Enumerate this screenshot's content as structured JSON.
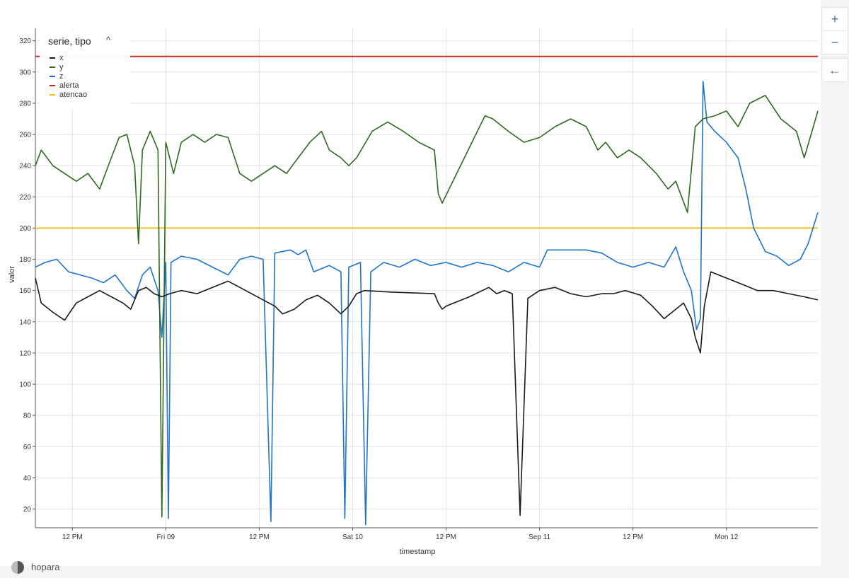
{
  "chart_data": {
    "type": "line",
    "xlabel": "timestamp",
    "ylabel": "valor",
    "ylim": [
      8,
      328
    ],
    "yticks": [
      20,
      40,
      60,
      80,
      100,
      120,
      140,
      160,
      180,
      200,
      220,
      240,
      260,
      280,
      300,
      320
    ],
    "xlim": [
      "2024-02-08 07:15",
      "2024-02-12 11:45"
    ],
    "xticks": [
      {
        "t": "2024-02-08 12:00",
        "label": "12 PM"
      },
      {
        "t": "2024-02-09 00:00",
        "label": "Fri 09"
      },
      {
        "t": "2024-02-09 12:00",
        "label": "12 PM"
      },
      {
        "t": "2024-02-10 00:00",
        "label": "Sat 10"
      },
      {
        "t": "2024-02-10 12:00",
        "label": "12 PM"
      },
      {
        "t": "2024-02-11 00:00",
        "label": "Sep 11"
      },
      {
        "t": "2024-02-11 12:00",
        "label": "12 PM"
      },
      {
        "t": "2024-02-12 00:00",
        "label": "Mon 12"
      }
    ],
    "legend_title": "serie, tipo",
    "legend_position": "top-left",
    "grid": true,
    "series": [
      {
        "name": "x",
        "color": "#1a1a1a",
        "points": [
          [
            "2024-02-08 07:15",
            168
          ],
          [
            "2024-02-08 08:00",
            152
          ],
          [
            "2024-02-08 09:30",
            146
          ],
          [
            "2024-02-08 11:00",
            141
          ],
          [
            "2024-02-08 12:30",
            152
          ],
          [
            "2024-02-08 14:00",
            156
          ],
          [
            "2024-02-08 15:30",
            160
          ],
          [
            "2024-02-08 17:00",
            156
          ],
          [
            "2024-02-08 18:30",
            152
          ],
          [
            "2024-02-08 19:30",
            148
          ],
          [
            "2024-02-08 20:30",
            160
          ],
          [
            "2024-02-08 21:30",
            162
          ],
          [
            "2024-02-08 22:30",
            158
          ],
          [
            "2024-02-08 23:30",
            156
          ],
          [
            "2024-02-09 00:30",
            158
          ],
          [
            "2024-02-09 02:00",
            160
          ],
          [
            "2024-02-09 04:00",
            158
          ],
          [
            "2024-02-09 06:00",
            162
          ],
          [
            "2024-02-09 08:00",
            166
          ],
          [
            "2024-02-09 09:30",
            162
          ],
          [
            "2024-02-09 11:00",
            158
          ],
          [
            "2024-02-09 12:30",
            154
          ],
          [
            "2024-02-09 14:00",
            150
          ],
          [
            "2024-02-09 15:00",
            145
          ],
          [
            "2024-02-09 16:30",
            148
          ],
          [
            "2024-02-09 18:00",
            154
          ],
          [
            "2024-02-09 19:30",
            157
          ],
          [
            "2024-02-09 21:00",
            152
          ],
          [
            "2024-02-09 22:30",
            145
          ],
          [
            "2024-02-09 23:30",
            150
          ],
          [
            "2024-02-10 00:30",
            158
          ],
          [
            "2024-02-10 01:30",
            160
          ],
          [
            "2024-02-10 05:00",
            159
          ],
          [
            "2024-02-10 10:30",
            158
          ],
          [
            "2024-02-10 11:00",
            152
          ],
          [
            "2024-02-10 11:30",
            148
          ],
          [
            "2024-02-10 12:00",
            150
          ],
          [
            "2024-02-10 15:00",
            156
          ],
          [
            "2024-02-10 17:30",
            162
          ],
          [
            "2024-02-10 18:30",
            158
          ],
          [
            "2024-02-10 19:30",
            160
          ],
          [
            "2024-02-10 20:30",
            158
          ],
          [
            "2024-02-10 21:30",
            16
          ],
          [
            "2024-02-10 22:30",
            155
          ],
          [
            "2024-02-11 00:00",
            160
          ],
          [
            "2024-02-11 02:00",
            162
          ],
          [
            "2024-02-11 04:00",
            158
          ],
          [
            "2024-02-11 06:00",
            156
          ],
          [
            "2024-02-11 08:00",
            158
          ],
          [
            "2024-02-11 09:30",
            158
          ],
          [
            "2024-02-11 11:00",
            160
          ],
          [
            "2024-02-11 13:00",
            157
          ],
          [
            "2024-02-11 14:30",
            150
          ],
          [
            "2024-02-11 16:00",
            142
          ],
          [
            "2024-02-11 17:30",
            148
          ],
          [
            "2024-02-11 18:30",
            152
          ],
          [
            "2024-02-11 19:30",
            142
          ],
          [
            "2024-02-11 20:00",
            130
          ],
          [
            "2024-02-11 20:40",
            120
          ],
          [
            "2024-02-11 21:10",
            150
          ],
          [
            "2024-02-11 22:00",
            172
          ],
          [
            "2024-02-11 23:00",
            170
          ],
          [
            "2024-02-12 00:00",
            168
          ],
          [
            "2024-02-12 02:00",
            164
          ],
          [
            "2024-02-12 04:00",
            160
          ],
          [
            "2024-02-12 06:00",
            160
          ],
          [
            "2024-02-12 08:00",
            158
          ],
          [
            "2024-02-12 10:00",
            156
          ],
          [
            "2024-02-12 11:45",
            154
          ]
        ]
      },
      {
        "name": "y",
        "color": "#2d6a1e",
        "points": [
          [
            "2024-02-08 07:15",
            240
          ],
          [
            "2024-02-08 08:00",
            250
          ],
          [
            "2024-02-08 09:30",
            240
          ],
          [
            "2024-02-08 11:00",
            235
          ],
          [
            "2024-02-08 12:30",
            230
          ],
          [
            "2024-02-08 14:00",
            235
          ],
          [
            "2024-02-08 15:30",
            225
          ],
          [
            "2024-02-08 17:00",
            245
          ],
          [
            "2024-02-08 18:00",
            258
          ],
          [
            "2024-02-08 19:00",
            260
          ],
          [
            "2024-02-08 20:00",
            240
          ],
          [
            "2024-02-08 20:30",
            190
          ],
          [
            "2024-02-08 21:00",
            250
          ],
          [
            "2024-02-08 22:00",
            262
          ],
          [
            "2024-02-08 23:00",
            250
          ],
          [
            "2024-02-08 23:30",
            15
          ],
          [
            "2024-02-09 00:00",
            255
          ],
          [
            "2024-02-09 01:00",
            235
          ],
          [
            "2024-02-09 02:00",
            255
          ],
          [
            "2024-02-09 03:30",
            260
          ],
          [
            "2024-02-09 05:00",
            255
          ],
          [
            "2024-02-09 06:30",
            260
          ],
          [
            "2024-02-09 08:00",
            258
          ],
          [
            "2024-02-09 09:30",
            235
          ],
          [
            "2024-02-09 11:00",
            230
          ],
          [
            "2024-02-09 12:30",
            235
          ],
          [
            "2024-02-09 14:00",
            240
          ],
          [
            "2024-02-09 15:30",
            235
          ],
          [
            "2024-02-09 17:00",
            245
          ],
          [
            "2024-02-09 18:30",
            255
          ],
          [
            "2024-02-09 20:00",
            262
          ],
          [
            "2024-02-09 21:00",
            250
          ],
          [
            "2024-02-09 22:30",
            245
          ],
          [
            "2024-02-09 23:30",
            240
          ],
          [
            "2024-02-10 00:30",
            245
          ],
          [
            "2024-02-10 02:30",
            262
          ],
          [
            "2024-02-10 04:30",
            268
          ],
          [
            "2024-02-10 06:30",
            262
          ],
          [
            "2024-02-10 08:30",
            255
          ],
          [
            "2024-02-10 10:30",
            250
          ],
          [
            "2024-02-10 11:00",
            222
          ],
          [
            "2024-02-10 11:30",
            216
          ],
          [
            "2024-02-10 17:00",
            272
          ],
          [
            "2024-02-10 18:00",
            270
          ],
          [
            "2024-02-10 20:00",
            262
          ],
          [
            "2024-02-10 22:00",
            255
          ],
          [
            "2024-02-11 00:00",
            258
          ],
          [
            "2024-02-11 02:00",
            265
          ],
          [
            "2024-02-11 04:00",
            270
          ],
          [
            "2024-02-11 06:00",
            265
          ],
          [
            "2024-02-11 07:30",
            250
          ],
          [
            "2024-02-11 08:30",
            255
          ],
          [
            "2024-02-11 10:00",
            245
          ],
          [
            "2024-02-11 11:30",
            250
          ],
          [
            "2024-02-11 13:00",
            245
          ],
          [
            "2024-02-11 15:00",
            235
          ],
          [
            "2024-02-11 16:30",
            225
          ],
          [
            "2024-02-11 17:30",
            230
          ],
          [
            "2024-02-11 19:00",
            210
          ],
          [
            "2024-02-11 20:00",
            265
          ],
          [
            "2024-02-11 21:00",
            270
          ],
          [
            "2024-02-11 22:30",
            272
          ],
          [
            "2024-02-12 00:00",
            275
          ],
          [
            "2024-02-12 01:30",
            265
          ],
          [
            "2024-02-12 03:00",
            280
          ],
          [
            "2024-02-12 05:00",
            285
          ],
          [
            "2024-02-12 07:00",
            270
          ],
          [
            "2024-02-12 09:00",
            262
          ],
          [
            "2024-02-12 10:00",
            245
          ],
          [
            "2024-02-12 11:00",
            262
          ],
          [
            "2024-02-12 11:45",
            275
          ]
        ]
      },
      {
        "name": "z",
        "color": "#1f74c9",
        "points": [
          [
            "2024-02-08 07:15",
            175
          ],
          [
            "2024-02-08 08:30",
            178
          ],
          [
            "2024-02-08 10:00",
            180
          ],
          [
            "2024-02-08 11:30",
            172
          ],
          [
            "2024-02-08 13:00",
            170
          ],
          [
            "2024-02-08 14:30",
            168
          ],
          [
            "2024-02-08 16:00",
            165
          ],
          [
            "2024-02-08 17:30",
            170
          ],
          [
            "2024-02-08 19:00",
            160
          ],
          [
            "2024-02-08 20:00",
            155
          ],
          [
            "2024-02-08 21:00",
            170
          ],
          [
            "2024-02-08 22:00",
            175
          ],
          [
            "2024-02-08 23:00",
            160
          ],
          [
            "2024-02-08 23:30",
            130
          ],
          [
            "2024-02-09 00:00",
            178
          ],
          [
            "2024-02-09 00:20",
            14
          ],
          [
            "2024-02-09 00:40",
            178
          ],
          [
            "2024-02-09 02:00",
            182
          ],
          [
            "2024-02-09 04:00",
            180
          ],
          [
            "2024-02-09 06:00",
            175
          ],
          [
            "2024-02-09 08:00",
            170
          ],
          [
            "2024-02-09 09:30",
            180
          ],
          [
            "2024-02-09 11:00",
            182
          ],
          [
            "2024-02-09 12:30",
            180
          ],
          [
            "2024-02-09 13:30",
            12
          ],
          [
            "2024-02-09 14:00",
            184
          ],
          [
            "2024-02-09 16:00",
            186
          ],
          [
            "2024-02-09 17:00",
            183
          ],
          [
            "2024-02-09 18:00",
            186
          ],
          [
            "2024-02-09 19:00",
            172
          ],
          [
            "2024-02-09 21:00",
            176
          ],
          [
            "2024-02-09 22:30",
            172
          ],
          [
            "2024-02-09 23:00",
            14
          ],
          [
            "2024-02-09 23:30",
            175
          ],
          [
            "2024-02-10 01:00",
            178
          ],
          [
            "2024-02-10 01:40",
            10
          ],
          [
            "2024-02-10 02:20",
            172
          ],
          [
            "2024-02-10 04:00",
            178
          ],
          [
            "2024-02-10 06:00",
            175
          ],
          [
            "2024-02-10 08:00",
            180
          ],
          [
            "2024-02-10 10:00",
            176
          ],
          [
            "2024-02-10 12:00",
            178
          ],
          [
            "2024-02-10 14:00",
            175
          ],
          [
            "2024-02-10 16:00",
            178
          ],
          [
            "2024-02-10 18:00",
            176
          ],
          [
            "2024-02-10 20:00",
            172
          ],
          [
            "2024-02-10 22:00",
            178
          ],
          [
            "2024-02-11 00:00",
            175
          ],
          [
            "2024-02-11 01:00",
            186
          ],
          [
            "2024-02-11 06:00",
            186
          ],
          [
            "2024-02-11 08:00",
            184
          ],
          [
            "2024-02-11 10:00",
            178
          ],
          [
            "2024-02-11 12:00",
            175
          ],
          [
            "2024-02-11 14:00",
            178
          ],
          [
            "2024-02-11 16:00",
            175
          ],
          [
            "2024-02-11 17:30",
            188
          ],
          [
            "2024-02-11 18:30",
            172
          ],
          [
            "2024-02-11 19:30",
            160
          ],
          [
            "2024-02-11 20:10",
            135
          ],
          [
            "2024-02-11 20:40",
            142
          ],
          [
            "2024-02-11 21:00",
            294
          ],
          [
            "2024-02-11 21:30",
            268
          ],
          [
            "2024-02-11 22:30",
            262
          ],
          [
            "2024-02-12 00:00",
            255
          ],
          [
            "2024-02-12 01:30",
            245
          ],
          [
            "2024-02-12 02:30",
            225
          ],
          [
            "2024-02-12 03:30",
            200
          ],
          [
            "2024-02-12 05:00",
            185
          ],
          [
            "2024-02-12 06:30",
            182
          ],
          [
            "2024-02-12 08:00",
            176
          ],
          [
            "2024-02-12 09:30",
            180
          ],
          [
            "2024-02-12 10:30",
            190
          ],
          [
            "2024-02-12 11:45",
            210
          ]
        ]
      },
      {
        "name": "alerta",
        "color": "#cc2a1c",
        "points": [
          [
            "2024-02-08 07:15",
            310
          ],
          [
            "2024-02-12 11:45",
            310
          ]
        ]
      },
      {
        "name": "atencao",
        "color": "#f2c023",
        "points": [
          [
            "2024-02-08 07:15",
            200
          ],
          [
            "2024-02-12 11:45",
            200
          ]
        ]
      }
    ]
  },
  "controls": {
    "zoom_in": "+",
    "zoom_out": "−",
    "back": "←"
  },
  "brand": {
    "name": "hopara"
  }
}
